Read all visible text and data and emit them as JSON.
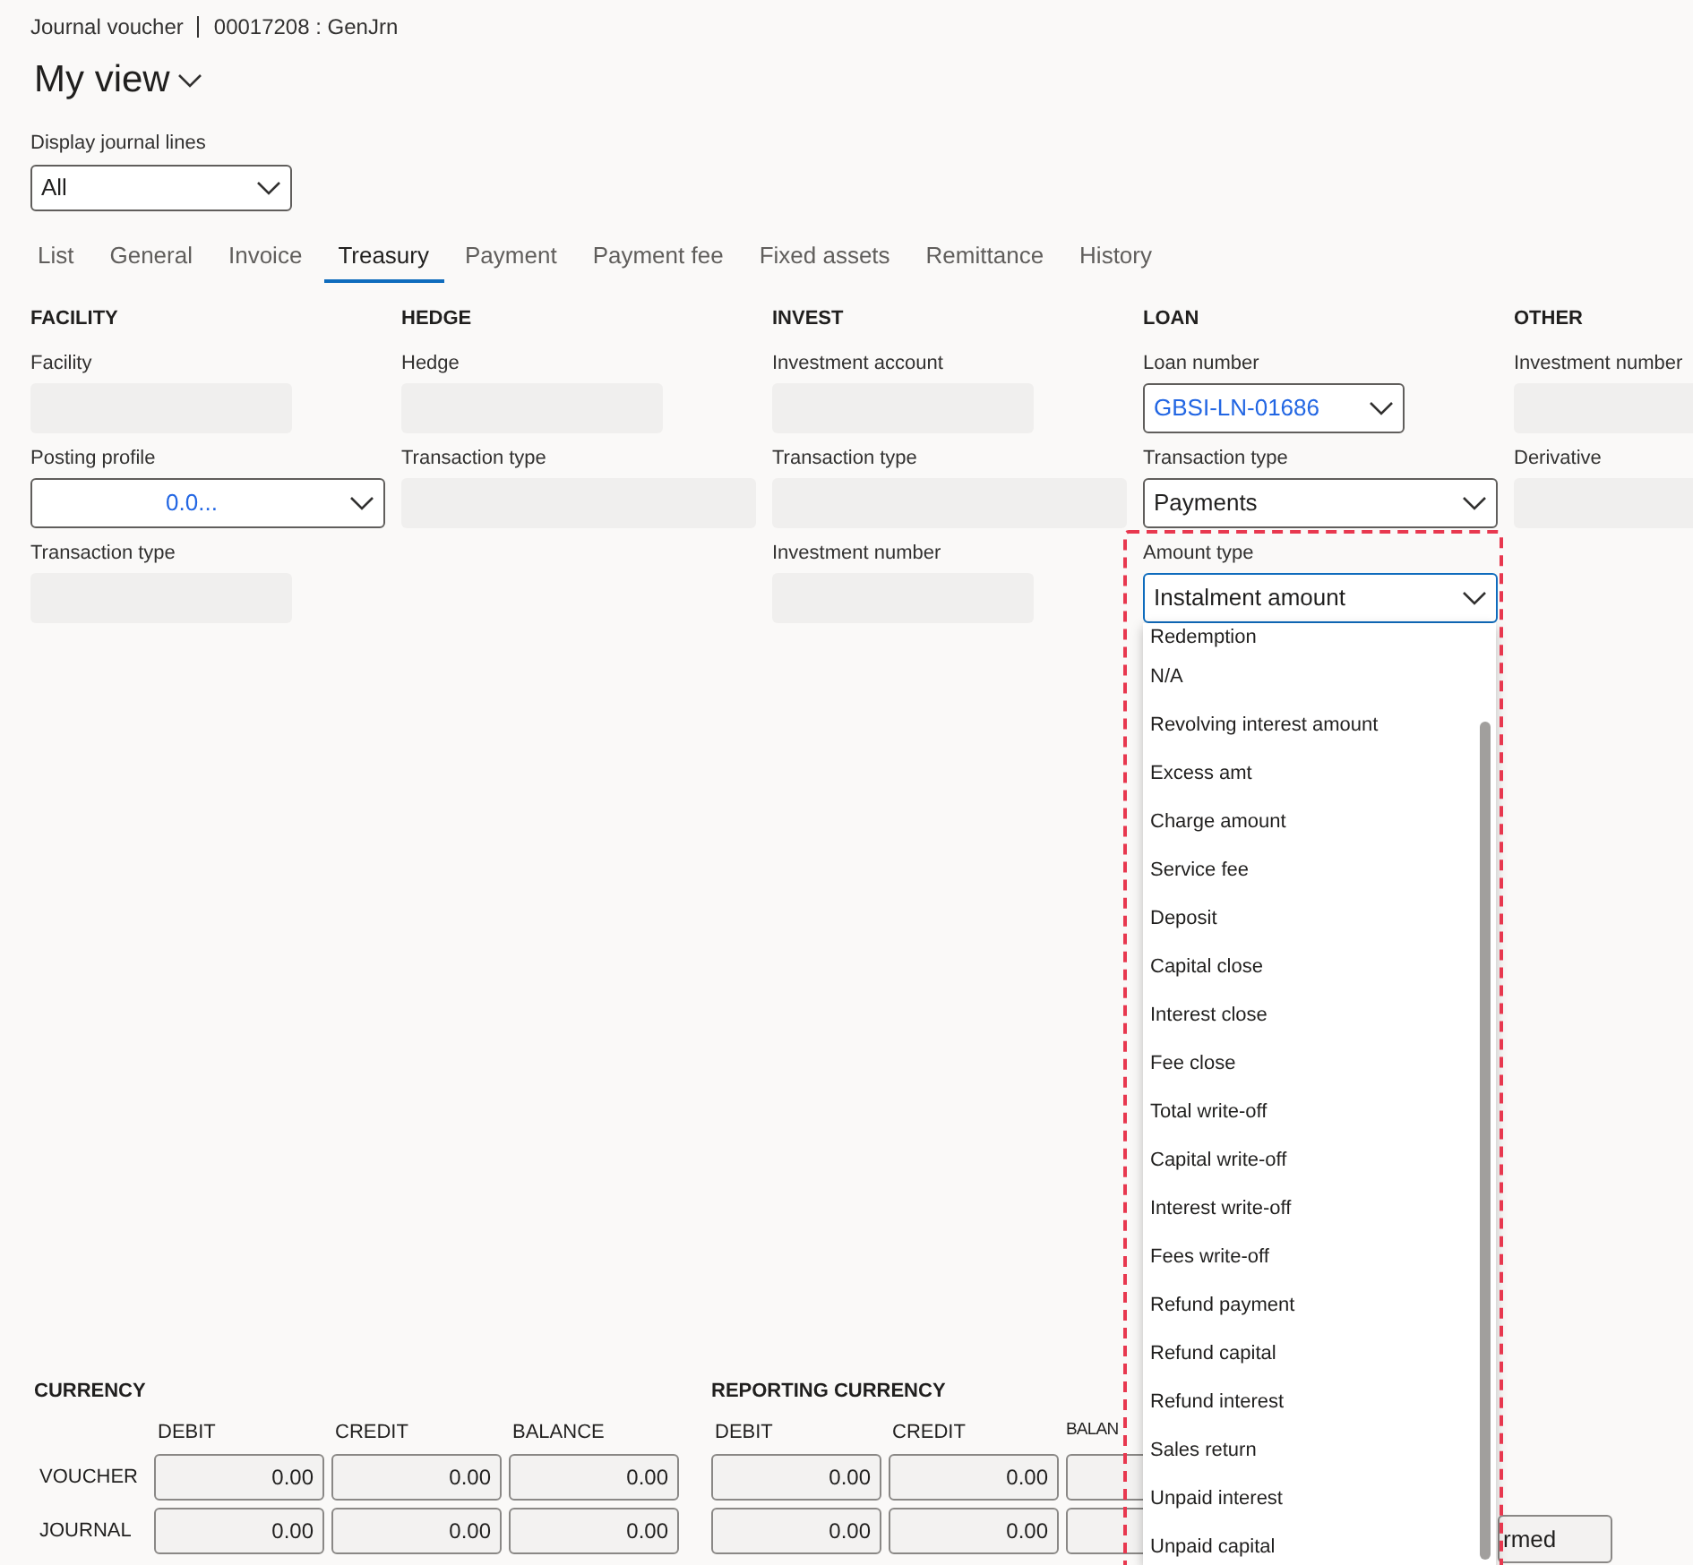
{
  "header": {
    "breadcrumb": "Journal voucher",
    "record": "00017208 : GenJrn"
  },
  "view_title": "My view",
  "display_lines": {
    "label": "Display journal lines",
    "value": "All"
  },
  "tabs": [
    {
      "label": "List",
      "selected": false
    },
    {
      "label": "General",
      "selected": false
    },
    {
      "label": "Invoice",
      "selected": false
    },
    {
      "label": "Treasury",
      "selected": true
    },
    {
      "label": "Payment",
      "selected": false
    },
    {
      "label": "Payment fee",
      "selected": false
    },
    {
      "label": "Fixed assets",
      "selected": false
    },
    {
      "label": "Remittance",
      "selected": false
    },
    {
      "label": "History",
      "selected": false
    }
  ],
  "sections": [
    {
      "title": "FACILITY",
      "fields": [
        {
          "label": "Facility",
          "kind": "box"
        },
        {
          "label": "Posting profile",
          "kind": "wide-combo",
          "value": "0.0...",
          "link": true
        },
        {
          "label": "Transaction type",
          "kind": "box"
        }
      ]
    },
    {
      "title": "HEDGE",
      "fields": [
        {
          "label": "Hedge",
          "kind": "box"
        },
        {
          "label": "Transaction type",
          "kind": "wide-box"
        }
      ]
    },
    {
      "title": "INVEST",
      "fields": [
        {
          "label": "Investment account",
          "kind": "box"
        },
        {
          "label": "Transaction type",
          "kind": "wide-box"
        },
        {
          "label": "Investment number",
          "kind": "box"
        }
      ]
    },
    {
      "title": "LOAN",
      "fields": [
        {
          "label": "Loan number",
          "kind": "combo",
          "value": "GBSI-LN-01686",
          "link": true
        },
        {
          "label": "Transaction type",
          "kind": "wide-combo",
          "value": "Payments",
          "link": false
        },
        {
          "label": "Amount type",
          "kind": "wide-combo",
          "value": "Instalment amount",
          "link": false,
          "expanded": true,
          "options": [
            "Redemption",
            "N/A",
            "Revolving interest amount",
            "Excess amt",
            "Charge amount",
            "Service fee",
            "Deposit",
            "Capital close",
            "Interest close",
            "Fee close",
            "Total write-off",
            "Capital write-off",
            "Interest write-off",
            "Fees write-off",
            "Refund payment",
            "Refund capital",
            "Refund interest",
            "Sales return",
            "Unpaid interest",
            "Unpaid capital"
          ]
        }
      ]
    },
    {
      "title": "OTHER",
      "fields": [
        {
          "label": "Investment number",
          "kind": "box"
        },
        {
          "label": "Derivative",
          "kind": "box"
        }
      ]
    }
  ],
  "totals": [
    {
      "title": "CURRENCY",
      "columns": [
        "DEBIT",
        "CREDIT",
        "BALANCE"
      ],
      "rows": [
        {
          "label": "VOUCHER",
          "values": [
            "0.00",
            "0.00",
            "0.00"
          ]
        },
        {
          "label": "JOURNAL",
          "values": [
            "0.00",
            "0.00",
            "0.00"
          ]
        }
      ]
    },
    {
      "title": "REPORTING CURRENCY",
      "columns": [
        "DEBIT",
        "CREDIT",
        "BALAN"
      ],
      "rows": [
        {
          "values": [
            "0.00",
            "0.00"
          ]
        },
        {
          "values": [
            "0.00",
            "0.00"
          ]
        }
      ]
    }
  ],
  "status_button": {
    "label": "rmed"
  }
}
